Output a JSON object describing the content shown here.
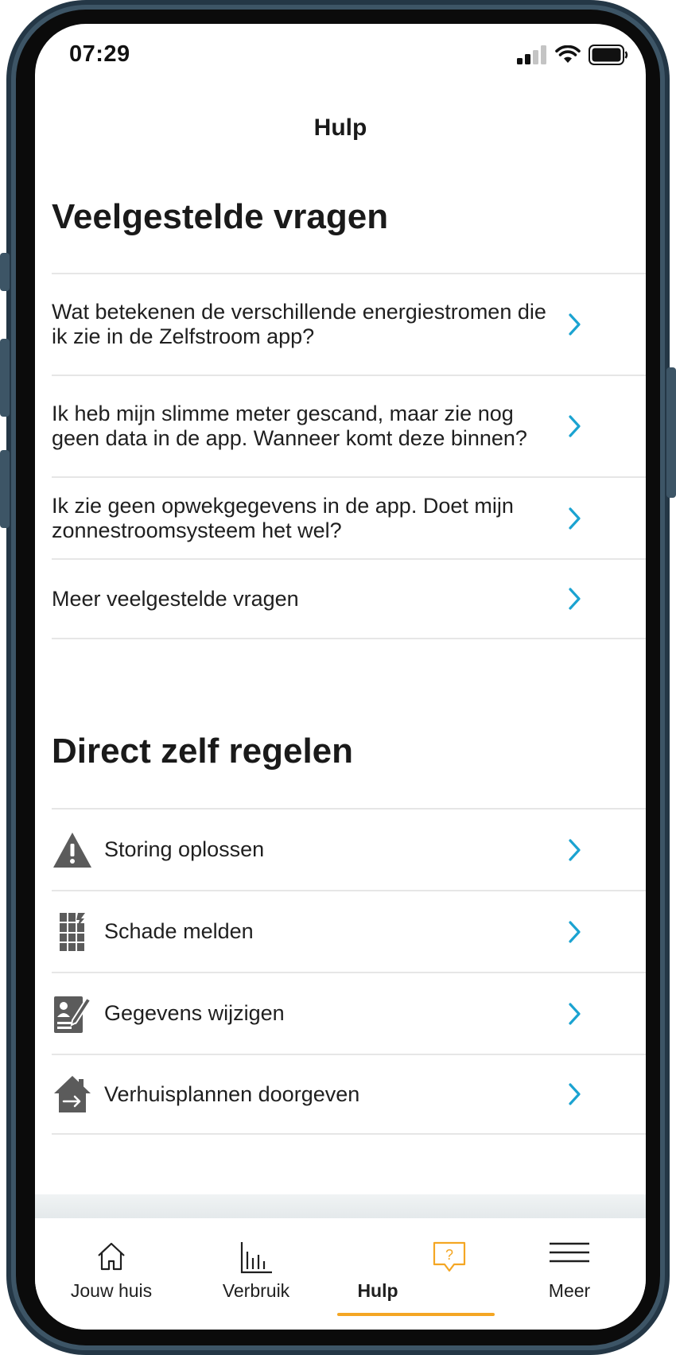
{
  "status_bar": {
    "time": "07:29"
  },
  "header": {
    "title": "Hulp"
  },
  "faq": {
    "title": "Veelgestelde vragen",
    "items": [
      {
        "label": "Wat betekenen de verschillende energiestromen die ik zie in de Zelfstroom app?"
      },
      {
        "label": "Ik heb mijn slimme meter gescand, maar zie nog geen data in de app. Wanneer komt deze binnen?"
      },
      {
        "label": "Ik zie geen opwekgegevens in de app. Doet mijn zonnestroomsysteem het wel?"
      },
      {
        "label": "Meer veelgestelde vragen"
      }
    ]
  },
  "self_service": {
    "title": "Direct zelf regelen",
    "items": [
      {
        "label": "Storing oplossen",
        "icon": "warning-icon"
      },
      {
        "label": "Schade melden",
        "icon": "broken-panel-icon"
      },
      {
        "label": "Gegevens wijzigen",
        "icon": "edit-profile-icon"
      },
      {
        "label": "Verhuisplannen doorgeven",
        "icon": "house-move-icon"
      }
    ]
  },
  "tabbar": {
    "tabs": [
      {
        "label": "Jouw huis",
        "icon": "house-icon"
      },
      {
        "label": "Verbruik",
        "icon": "bar-chart-icon"
      },
      {
        "label": "Hulp",
        "icon": "help-bubble-icon",
        "active": true
      },
      {
        "label": "Meer",
        "icon": "menu-icon"
      }
    ]
  },
  "colors": {
    "accent": "#1ba3d1",
    "active_tab": "#f4a623",
    "text": "#1f1f1f",
    "icon_grey": "#5b5b5b"
  }
}
